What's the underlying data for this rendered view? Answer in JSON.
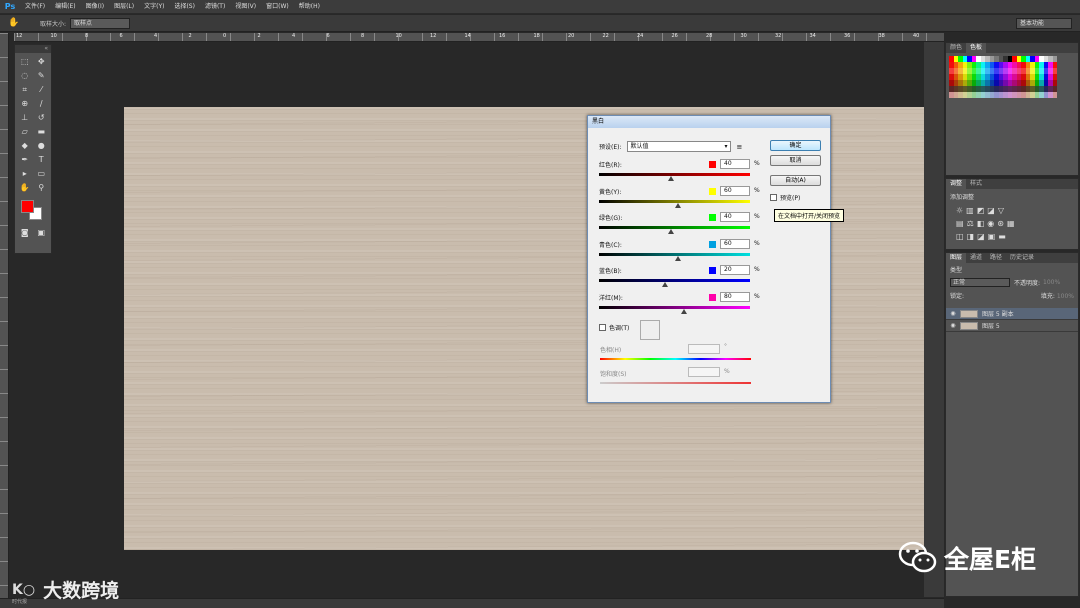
{
  "app": {
    "logo": "Ps"
  },
  "menu": [
    "文件(F)",
    "编辑(E)",
    "图像(I)",
    "图层(L)",
    "文字(Y)",
    "选择(S)",
    "滤镜(T)",
    "视图(V)",
    "窗口(W)",
    "帮助(H)"
  ],
  "options": {
    "tool_icon": "hand-icon",
    "sample_label": "取样大小:",
    "sample_value": "取样点",
    "workspace": "基本功能"
  },
  "rulers": {
    "top_numbers": [
      "12",
      "10",
      "8",
      "6",
      "4",
      "2",
      "0",
      "2",
      "4",
      "6",
      "8",
      "10",
      "12",
      "14",
      "16",
      "18",
      "20",
      "22",
      "24",
      "26",
      "28",
      "30",
      "32",
      "34",
      "36",
      "38",
      "40"
    ]
  },
  "colors": {
    "foreground": "#ff0000",
    "background": "#ffffff",
    "canvas_wood": "#c9bcad"
  },
  "dialog": {
    "title": "黑白",
    "preset_label": "预设(E):",
    "preset_value": "默认值",
    "buttons": {
      "ok": "确定",
      "cancel": "取消",
      "auto": "自动(A)"
    },
    "preview_label": "预览(P)",
    "tooltip": "在文档中打开/关闭预览",
    "sliders": [
      {
        "label": "红色(R):",
        "value": "40",
        "pct": "%",
        "swatch": "#ff0000",
        "position": 0.48,
        "gradient": "linear-gradient(90deg,#000,#ff0000)"
      },
      {
        "label": "黄色(Y):",
        "value": "60",
        "pct": "%",
        "swatch": "#ffff00",
        "position": 0.52,
        "gradient": "linear-gradient(90deg,#000,#ffff00)"
      },
      {
        "label": "绿色(G):",
        "value": "40",
        "pct": "%",
        "swatch": "#00ff00",
        "position": 0.48,
        "gradient": "linear-gradient(90deg,#000,#00ff00)"
      },
      {
        "label": "青色(C):",
        "value": "60",
        "pct": "%",
        "swatch": "#00a0e0",
        "position": 0.52,
        "gradient": "linear-gradient(90deg,#000,#00e0e0)"
      },
      {
        "label": "蓝色(B):",
        "value": "20",
        "pct": "%",
        "swatch": "#0000ff",
        "position": 0.44,
        "gradient": "linear-gradient(90deg,#000,#0000ff)"
      },
      {
        "label": "洋红(M):",
        "value": "80",
        "pct": "%",
        "swatch": "#ff00aa",
        "position": 0.56,
        "gradient": "linear-gradient(90deg,#000,#ff00ff)"
      }
    ],
    "tint_label": "色调(T)",
    "hue_label": "色相(H)",
    "hue_unit": "°",
    "sat_label": "饱和度(S)",
    "sat_unit": "%"
  },
  "panels": {
    "swatches_tabs": [
      "颜色",
      "色板"
    ],
    "adjust_tabs": [
      "调整",
      "样式"
    ],
    "adjust_title": "添加调整",
    "layer_tabs": [
      "图层",
      "通道",
      "路径",
      "历史记录"
    ],
    "layer_kind": "类型",
    "blend_mode": "正常",
    "opacity_label": "不透明度:",
    "opacity_value": "100%",
    "lock_label": "锁定:",
    "fill_label": "填充:",
    "fill_value": "100%",
    "layers": [
      {
        "name": "图层 5 副本",
        "selected": true
      },
      {
        "name": "图层 5",
        "selected": false
      }
    ]
  },
  "watermarks": {
    "left": "大数跨境",
    "left_small": "时代报",
    "right": "全屋E柜"
  }
}
